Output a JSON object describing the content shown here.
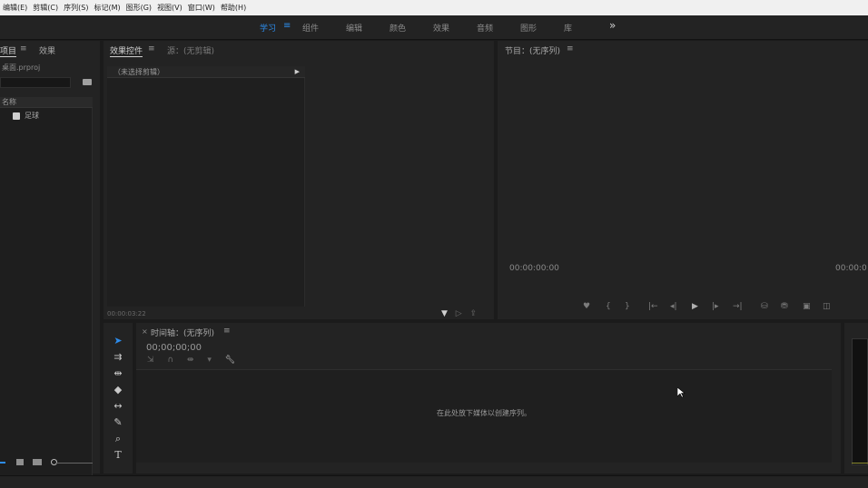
{
  "menu": [
    "编辑(E)",
    "剪辑(C)",
    "序列(S)",
    "标记(M)",
    "图形(G)",
    "视图(V)",
    "窗口(W)",
    "帮助(H)"
  ],
  "workspaces": {
    "items": [
      "学习",
      "组件",
      "编辑",
      "颜色",
      "效果",
      "音频",
      "图形",
      "库"
    ],
    "active": "学习",
    "more": "»"
  },
  "project": {
    "tab_active": "项目",
    "tab_other": "效果",
    "file": "桌面.prproj",
    "column_name": "名称",
    "items": [
      "足球"
    ]
  },
  "effect_controls": {
    "tab_active": "效果控件",
    "tab_other": "源：(无剪辑)",
    "row": "（未选择剪辑）",
    "timecode": "00:00:03:22"
  },
  "program": {
    "title": "节目：(无序列)",
    "timecode_left": "00:00:00:00",
    "timecode_right": "00:00:0"
  },
  "timeline": {
    "title": "时间轴：(无序列)",
    "timecode": "00;00;00;00",
    "empty_message": "在此处放下媒体以创建序列。"
  },
  "icons": {
    "menu": "hamburger-icon",
    "selection": "selection-tool-icon",
    "track_select": "track-select-icon",
    "ripple": "ripple-edit-icon",
    "razor": "razor-icon",
    "slip": "slip-icon",
    "pen": "pen-icon",
    "zoom": "zoom-icon",
    "type": "type-tool-icon",
    "wrench": "wrench-icon"
  },
  "colors": {
    "accent": "#2d8ceb",
    "panel": "#232323",
    "background": "#1b1b1b"
  }
}
